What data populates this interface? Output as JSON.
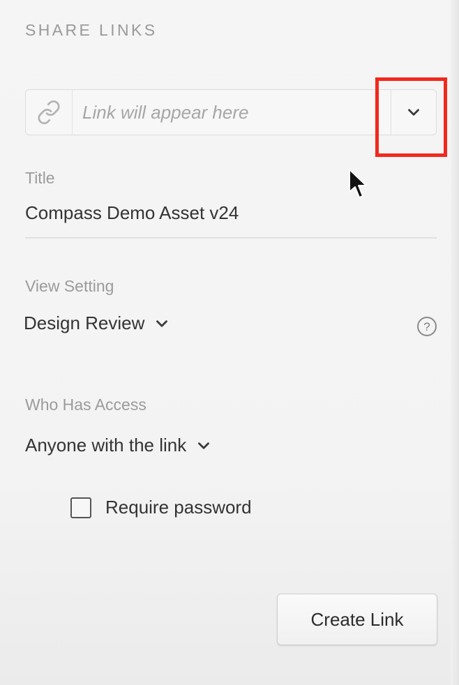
{
  "share_links": {
    "section_title": "SHARE LINKS",
    "link_field": {
      "icon": "link-icon",
      "placeholder": "Link will appear here",
      "value": "",
      "dropdown_icon": "chevron-down-icon"
    },
    "title": {
      "label": "Title",
      "value": "Compass Demo Asset v24"
    },
    "view_setting": {
      "label": "View Setting",
      "selected": "Design Review",
      "help_icon": "question-circle-icon"
    },
    "access": {
      "label": "Who Has Access",
      "selected": "Anyone with the link"
    },
    "require_password": {
      "label": "Require password",
      "checked": false
    },
    "create_button": {
      "label": "Create Link"
    }
  },
  "colors": {
    "highlight": "#f3281c",
    "background": "#f4f4f4",
    "label": "#9b9b9b",
    "text": "#333333"
  }
}
